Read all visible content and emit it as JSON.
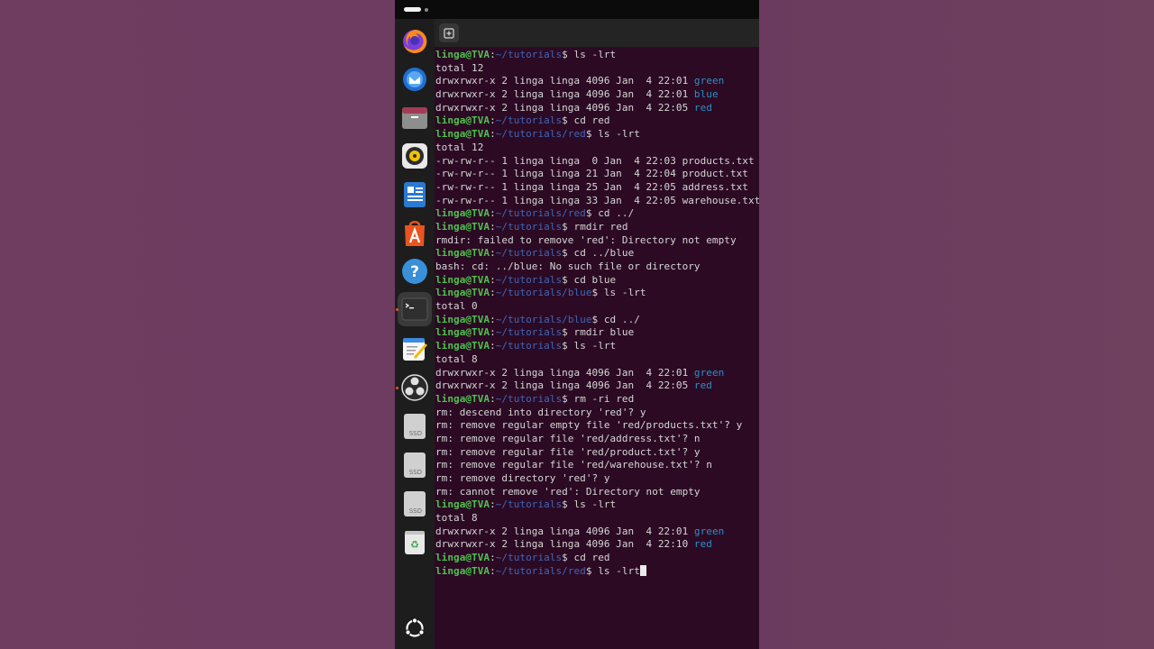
{
  "user_host": "linga@TVA",
  "path_segments": {
    "tutorials": "~/tutorials",
    "red": "~/tutorials/red",
    "blue": "~/tutorials/blue"
  },
  "dock": {
    "items": [
      "firefox-icon",
      "thunderbird-icon",
      "files-icon",
      "rhythmbox-icon",
      "writer-icon",
      "app-center-icon",
      "help-icon",
      "terminal-icon",
      "text-editor-icon",
      "obs-icon",
      "ssd-icon",
      "ssd-icon",
      "ssd-icon",
      "trash-icon",
      "show-apps-icon"
    ],
    "ssd_label": "SSD"
  },
  "lines": [
    {
      "type": "prompt",
      "cwd": "~/tutorials",
      "cmd": "ls -lrt"
    },
    {
      "type": "out",
      "text": "total 12"
    },
    {
      "type": "dir",
      "text": "drwxrwxr-x 2 linga linga 4096 Jan  4 22:01 ",
      "name": "green"
    },
    {
      "type": "dir",
      "text": "drwxrwxr-x 2 linga linga 4096 Jan  4 22:01 ",
      "name": "blue"
    },
    {
      "type": "dir",
      "text": "drwxrwxr-x 2 linga linga 4096 Jan  4 22:05 ",
      "name": "red"
    },
    {
      "type": "prompt",
      "cwd": "~/tutorials",
      "cmd": "cd red"
    },
    {
      "type": "prompt",
      "cwd": "~/tutorials/red",
      "cmd": "ls -lrt"
    },
    {
      "type": "out",
      "text": "total 12"
    },
    {
      "type": "out",
      "text": "-rw-rw-r-- 1 linga linga  0 Jan  4 22:03 products.txt"
    },
    {
      "type": "out",
      "text": "-rw-rw-r-- 1 linga linga 21 Jan  4 22:04 product.txt"
    },
    {
      "type": "out",
      "text": "-rw-rw-r-- 1 linga linga 25 Jan  4 22:05 address.txt"
    },
    {
      "type": "out",
      "text": "-rw-rw-r-- 1 linga linga 33 Jan  4 22:05 warehouse.txt"
    },
    {
      "type": "prompt",
      "cwd": "~/tutorials/red",
      "cmd": "cd ../"
    },
    {
      "type": "prompt",
      "cwd": "~/tutorials",
      "cmd": "rmdir red"
    },
    {
      "type": "out",
      "text": "rmdir: failed to remove 'red': Directory not empty"
    },
    {
      "type": "prompt",
      "cwd": "~/tutorials",
      "cmd": "cd ../blue"
    },
    {
      "type": "out",
      "text": "bash: cd: ../blue: No such file or directory"
    },
    {
      "type": "prompt",
      "cwd": "~/tutorials",
      "cmd": "cd blue"
    },
    {
      "type": "prompt",
      "cwd": "~/tutorials/blue",
      "cmd": "ls -lrt"
    },
    {
      "type": "out",
      "text": "total 0"
    },
    {
      "type": "prompt",
      "cwd": "~/tutorials/blue",
      "cmd": "cd ../"
    },
    {
      "type": "prompt",
      "cwd": "~/tutorials",
      "cmd": "rmdir blue"
    },
    {
      "type": "prompt",
      "cwd": "~/tutorials",
      "cmd": "ls -lrt"
    },
    {
      "type": "out",
      "text": "total 8"
    },
    {
      "type": "dir",
      "text": "drwxrwxr-x 2 linga linga 4096 Jan  4 22:01 ",
      "name": "green"
    },
    {
      "type": "dir",
      "text": "drwxrwxr-x 2 linga linga 4096 Jan  4 22:05 ",
      "name": "red"
    },
    {
      "type": "prompt",
      "cwd": "~/tutorials",
      "cmd": "rm -ri red"
    },
    {
      "type": "out",
      "text": "rm: descend into directory 'red'? y"
    },
    {
      "type": "out",
      "text": "rm: remove regular empty file 'red/products.txt'? y"
    },
    {
      "type": "out",
      "text": "rm: remove regular file 'red/address.txt'? n"
    },
    {
      "type": "out",
      "text": "rm: remove regular file 'red/product.txt'? y"
    },
    {
      "type": "out",
      "text": "rm: remove regular file 'red/warehouse.txt'? n"
    },
    {
      "type": "out",
      "text": "rm: remove directory 'red'? y"
    },
    {
      "type": "out",
      "text": "rm: cannot remove 'red': Directory not empty"
    },
    {
      "type": "prompt",
      "cwd": "~/tutorials",
      "cmd": "ls -lrt"
    },
    {
      "type": "out",
      "text": "total 8"
    },
    {
      "type": "dir",
      "text": "drwxrwxr-x 2 linga linga 4096 Jan  4 22:01 ",
      "name": "green"
    },
    {
      "type": "dir",
      "text": "drwxrwxr-x 2 linga linga 4096 Jan  4 22:10 ",
      "name": "red"
    },
    {
      "type": "prompt",
      "cwd": "~/tutorials",
      "cmd": "cd red"
    },
    {
      "type": "prompt",
      "cwd": "~/tutorials/red",
      "cmd": "ls -lrt",
      "cursor": true
    }
  ],
  "colors": {
    "user": "#4ec24e",
    "path": "#3f67b8",
    "dir_name": "#2a8fc8",
    "text": "#d6d6d6",
    "terminal_bg": "#2c0a24",
    "desktop_bg": "#6f3e62"
  }
}
